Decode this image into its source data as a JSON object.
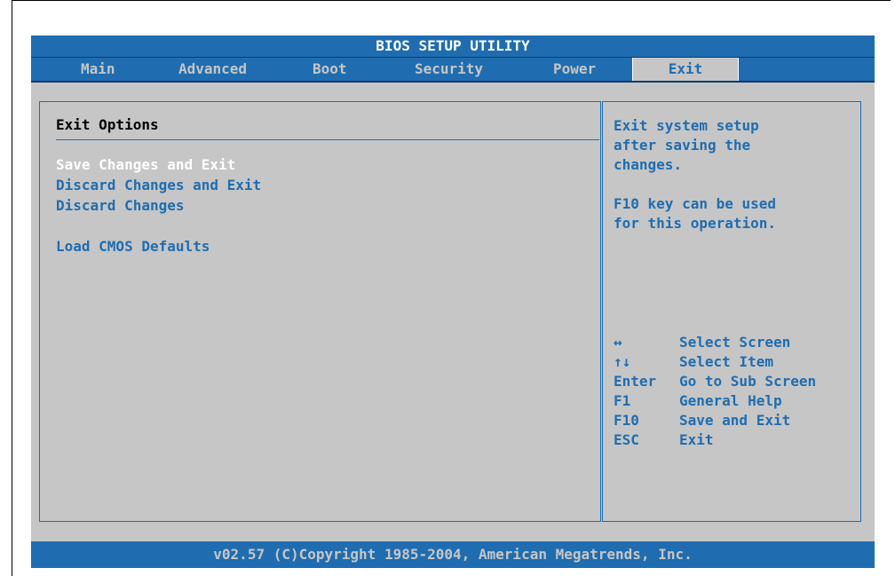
{
  "title": "BIOS SETUP UTILITY",
  "menu": [
    "Main",
    "Advanced",
    "Boot",
    "Security",
    "Power",
    "Exit"
  ],
  "active_menu": "Exit",
  "section_title": "Exit Options",
  "options": [
    {
      "label": "Save Changes and Exit",
      "selected": true
    },
    {
      "label": "Discard Changes and Exit",
      "selected": false
    },
    {
      "label": "Discard Changes",
      "selected": false
    },
    {
      "label": "Load CMOS Defaults",
      "selected": false
    }
  ],
  "help": {
    "lines1": [
      "Exit system setup",
      "after saving the",
      "changes."
    ],
    "lines2": [
      "F10 key can be used",
      "for this operation."
    ]
  },
  "keys": [
    {
      "key": "↔",
      "action": "Select Screen"
    },
    {
      "key": "↑↓",
      "action": "Select Item"
    },
    {
      "key": "Enter",
      "action": "Go to Sub Screen"
    },
    {
      "key": "F1",
      "action": "General Help"
    },
    {
      "key": "F10",
      "action": "Save and Exit"
    },
    {
      "key": "ESC",
      "action": "Exit"
    }
  ],
  "footer": "v02.57 (C)Copyright 1985-2004, American Megatrends, Inc.",
  "colors": {
    "accent": "#1f6db0",
    "background": "#c6c6c6",
    "selected_text": "#ffffff"
  }
}
